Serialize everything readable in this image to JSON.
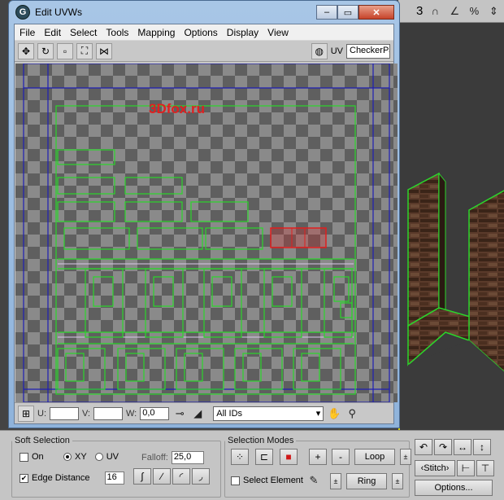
{
  "window": {
    "title": "Edit UVWs"
  },
  "menu": [
    "File",
    "Edit",
    "Select",
    "Tools",
    "Mapping",
    "Options",
    "Display",
    "View"
  ],
  "toolbar": {
    "uv_label": "UV",
    "map_value": "CheckerPa"
  },
  "watermark": "3Dfox.ru",
  "uv_bottom": {
    "u_label": "U:",
    "v_label": "V:",
    "w_label": "W:",
    "w_value": "0,0",
    "id_select": "All IDs"
  },
  "max_toolbar": {
    "number": "3"
  },
  "soft_selection": {
    "legend": "Soft Selection",
    "on_label": "On",
    "xy_label": "XY",
    "uv_label": "UV",
    "falloff_label": "Falloff:",
    "falloff_value": "25,0",
    "edge_distance_label": "Edge Distance",
    "edge_distance_checked": true,
    "edge_distance_value": "16"
  },
  "selection_modes": {
    "legend": "Selection Modes",
    "select_element_label": "Select Element",
    "loop_label": "Loop",
    "ring_label": "Ring",
    "plus": "+",
    "minus": "-"
  },
  "right_tools": {
    "stitch_label": "Stitch",
    "options_label": "Options..."
  },
  "colors": {
    "uv_edge": "#2bd62b",
    "uv_border": "#1e1eb4",
    "selected": "#e01f1f",
    "viewport_frame": "#d8d500"
  }
}
